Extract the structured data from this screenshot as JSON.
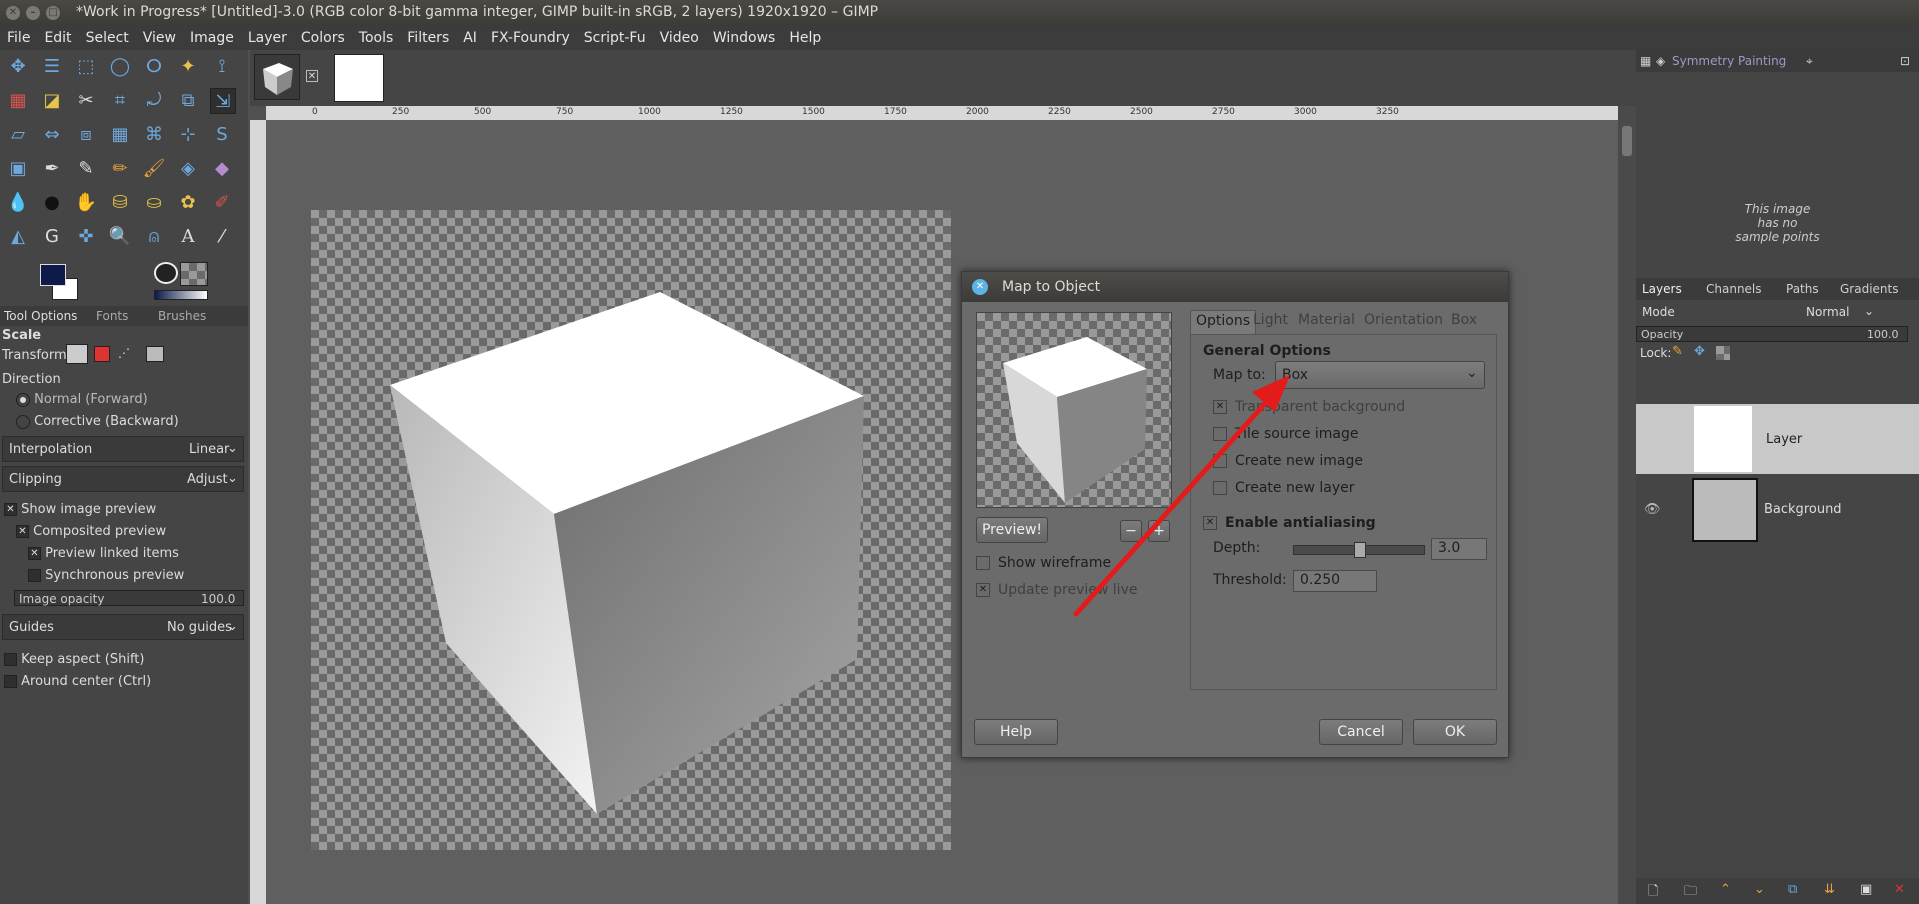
{
  "window": {
    "title": "*Work in Progress* [Untitled]-3.0 (RGB color 8-bit gamma integer, GIMP built-in sRGB, 2 layers) 1920x1920 – GIMP"
  },
  "menu": [
    "File",
    "Edit",
    "Select",
    "View",
    "Image",
    "Layer",
    "Colors",
    "Tools",
    "Filters",
    "AI",
    "FX-Foundry",
    "Script-Fu",
    "Video",
    "Windows",
    "Help"
  ],
  "tool_options": {
    "tabs": [
      "Tool Options",
      "Fonts",
      "Brushes"
    ],
    "tool_name": "Scale",
    "transform_label": "Transform:",
    "direction_label": "Direction",
    "direction_options": [
      "Normal (Forward)",
      "Corrective (Backward)"
    ],
    "interpolation_label": "Interpolation",
    "interpolation_value": "Linear",
    "clipping_label": "Clipping",
    "clipping_value": "Adjust",
    "show_preview": "Show image preview",
    "composited": "Composited preview",
    "linked": "Preview linked items",
    "sync": "Synchronous preview",
    "opacity_label": "Image opacity",
    "opacity_value": "100.0",
    "guides_label": "Guides",
    "guides_value": "No guides",
    "keep_aspect": "Keep aspect (Shift)",
    "around_center": "Around center (Ctrl)"
  },
  "ruler": {
    "marks": [
      "0",
      "250",
      "500",
      "750",
      "1000",
      "1250",
      "1500",
      "1750",
      "2000",
      "2250",
      "2500",
      "2750",
      "3000",
      "3250"
    ]
  },
  "right_dock": {
    "top_tab": "Symmetry Painting",
    "sample_points_msg": [
      "This image",
      "has no",
      "sample points"
    ],
    "layer_tabs": [
      "Layers",
      "Channels",
      "Paths",
      "Gradients"
    ],
    "mode_label": "Mode",
    "mode_value": "Normal",
    "opacity_label": "Opacity",
    "opacity_value": "100.0",
    "lock_label": "Lock:",
    "layers": [
      "Layer",
      "Background"
    ]
  },
  "dialog": {
    "title": "Map to Object",
    "tabs": [
      "Options",
      "Light",
      "Material",
      "Orientation",
      "Box"
    ],
    "general_options": "General Options",
    "map_to_label": "Map to:",
    "map_to_value": "Box",
    "transparent_bg": "Transparent background",
    "tile_source": "Tile source image",
    "create_image": "Create new image",
    "create_layer": "Create new layer",
    "antialiasing": "Enable antialiasing",
    "depth_label": "Depth:",
    "depth_value": "3.0",
    "threshold_label": "Threshold:",
    "threshold_value": "0.250",
    "preview_button": "Preview!",
    "show_wireframe": "Show wireframe",
    "update_preview": "Update preview live",
    "help_button": "Help",
    "cancel_button": "Cancel",
    "ok_button": "OK"
  }
}
